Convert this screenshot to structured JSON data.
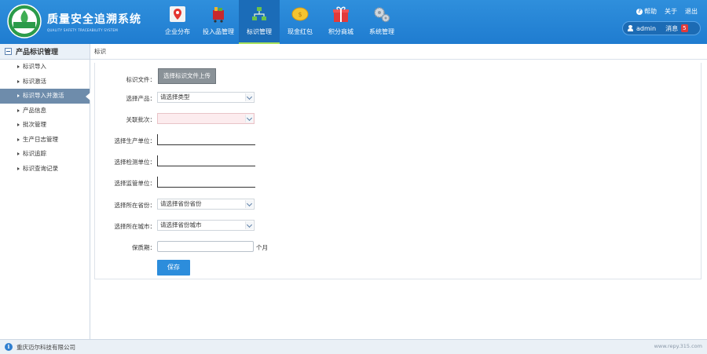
{
  "header": {
    "title": "质量安全追溯系统",
    "subtitle": "QUALITY SAFETY TRACEABILITY SYSTEM",
    "logo_text": "质量安全追溯",
    "nav": [
      {
        "label": "企业分布",
        "icon": "map-pin-icon"
      },
      {
        "label": "投入品管理",
        "icon": "cart-icon"
      },
      {
        "label": "标识管理",
        "icon": "hierarchy-icon",
        "active": true
      },
      {
        "label": "现金红包",
        "icon": "coin-icon"
      },
      {
        "label": "积分商城",
        "icon": "gift-icon"
      },
      {
        "label": "系统管理",
        "icon": "gears-icon"
      }
    ],
    "links": {
      "help": "帮助",
      "about": "关于",
      "logout": "退出"
    },
    "user": {
      "name": "admin",
      "message_label": "消息",
      "message_count": "5"
    }
  },
  "sidebar": {
    "title": "产品标识管理",
    "items": [
      {
        "label": "标识导入"
      },
      {
        "label": "标识激活"
      },
      {
        "label": "标识导入并激活",
        "active": true
      },
      {
        "label": "产品信息"
      },
      {
        "label": "批次管理"
      },
      {
        "label": "生产日志管理"
      },
      {
        "label": "标识追踪"
      },
      {
        "label": "标识查询记录"
      }
    ]
  },
  "breadcrumb": "标识",
  "form": {
    "file_label": "标识文件：",
    "upload_button": "选择标识文件上传",
    "product_label": "选择产品：",
    "product_value": "请选择类型",
    "batch_label": "关联批次：",
    "batch_value": "",
    "producer_label": "选择生产单位：",
    "inspector_label": "选择检测单位：",
    "supervisor_label": "选择监管单位：",
    "province_label": "选择所在省份：",
    "province_value": "请选择省份省份",
    "city_label": "选择所在城市：",
    "city_value": "请选择省份城市",
    "shelf_label": "保质期：",
    "shelf_unit": "个月",
    "save_button": "保存"
  },
  "footer": {
    "company": "重庆迈尔科技有限公司",
    "url": "www.repy.315.com"
  },
  "colors": {
    "header": "#1f7cd0",
    "sidebar_active": "#6e8cab",
    "save_button": "#2c8ddc",
    "upload_button": "#8a9298"
  }
}
